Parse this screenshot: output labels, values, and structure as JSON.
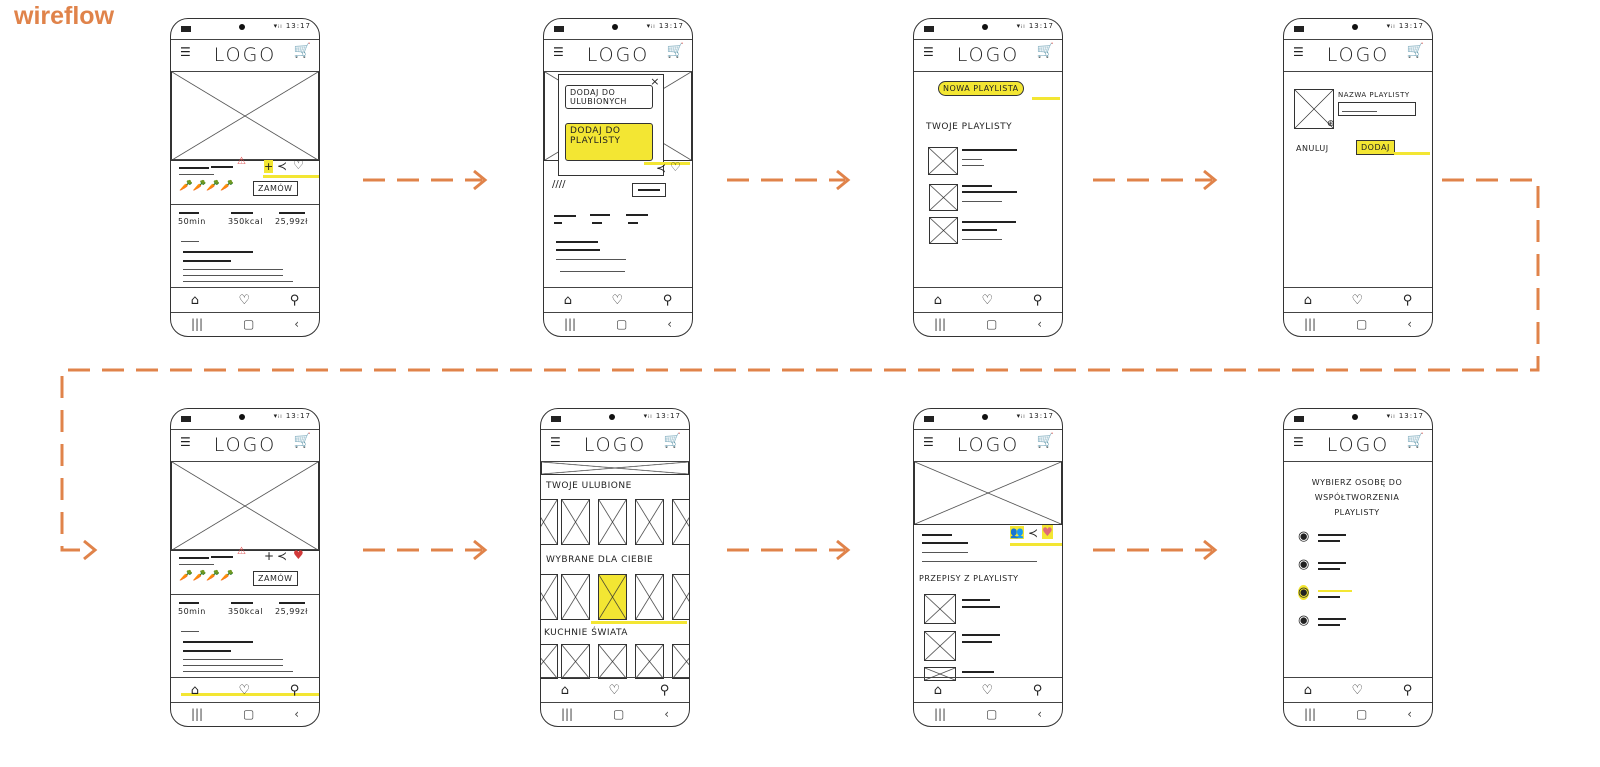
{
  "title": "wireflow",
  "colors": {
    "accent": "#e0834a",
    "highlight": "#f3e633",
    "heart": "#e06a78"
  },
  "common": {
    "logo": "LOGO",
    "signal": "▾ᵢₗ 13:17",
    "icons": [
      "menu-icon",
      "cart-icon",
      "home-icon",
      "heart-icon",
      "search-icon",
      "recents-icon",
      "home-button-icon",
      "back-icon"
    ]
  },
  "screens": {
    "s1": {
      "order": "ZAMÓW",
      "stats": [
        "50min",
        "350kcal",
        "25,99zł"
      ]
    },
    "s2": {
      "close": "×",
      "add_favorites": "DODAJ DO ULUBIONYCH",
      "add_playlist": "DODAJ DO PLAYLISTY"
    },
    "s3": {
      "new_playlist": "NOWA PLAYLISTA",
      "your_playlists": "TWOJE PLAYLISTY"
    },
    "s4": {
      "name_label": "NAZWA PLAYLISTY",
      "cancel": "ANULUJ",
      "add": "DODAJ"
    },
    "s5": {
      "order": "ZAMÓW",
      "stats": [
        "50min",
        "350kcal",
        "25,99zł"
      ]
    },
    "s6": {
      "favorites": "TWOJE ULUBIONE",
      "for_you": "WYBRANE DLA CIEBIE",
      "cuisines": "KUCHNIE ŚWIATA"
    },
    "s7": {
      "recipes": "PRZEPISY Z PLAYLISTY"
    },
    "s8": {
      "choose_person": "WYBIERZ OSOBĘ DO WSPÓŁTWORZENIA PLAYLISTY"
    }
  }
}
